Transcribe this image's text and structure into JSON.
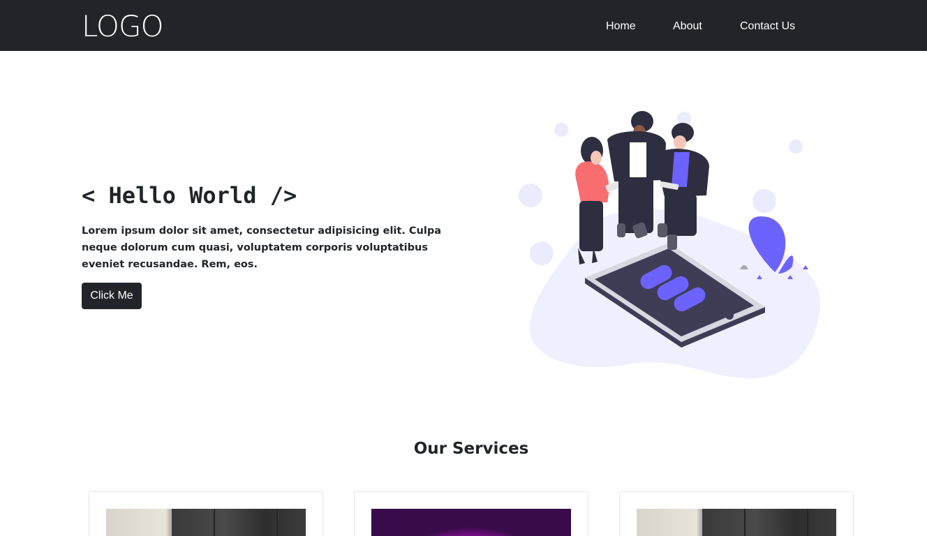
{
  "header": {
    "logo": "LOGO",
    "nav": [
      {
        "label": "Home"
      },
      {
        "label": "About"
      },
      {
        "label": "Contact Us"
      }
    ]
  },
  "hero": {
    "title": "< Hello World />",
    "text": "Lorem ipsum dolor sit amet, consectetur adipisicing elit. Culpa neque dolorum cum quasi, voluptatem corporis voluptatibus eveniet recusandae. Rem, eos.",
    "button_label": "Click Me",
    "illustration": "people-with-phone-illustration"
  },
  "services": {
    "title": "Our Services",
    "cards": [
      {
        "image": "door-photo"
      },
      {
        "image": "magenta-glow-photo"
      },
      {
        "image": "door-photo"
      }
    ]
  },
  "colors": {
    "navbar": "#212529",
    "button": "#212529",
    "accent": "#6c63ff",
    "blob": "#f0efff"
  }
}
